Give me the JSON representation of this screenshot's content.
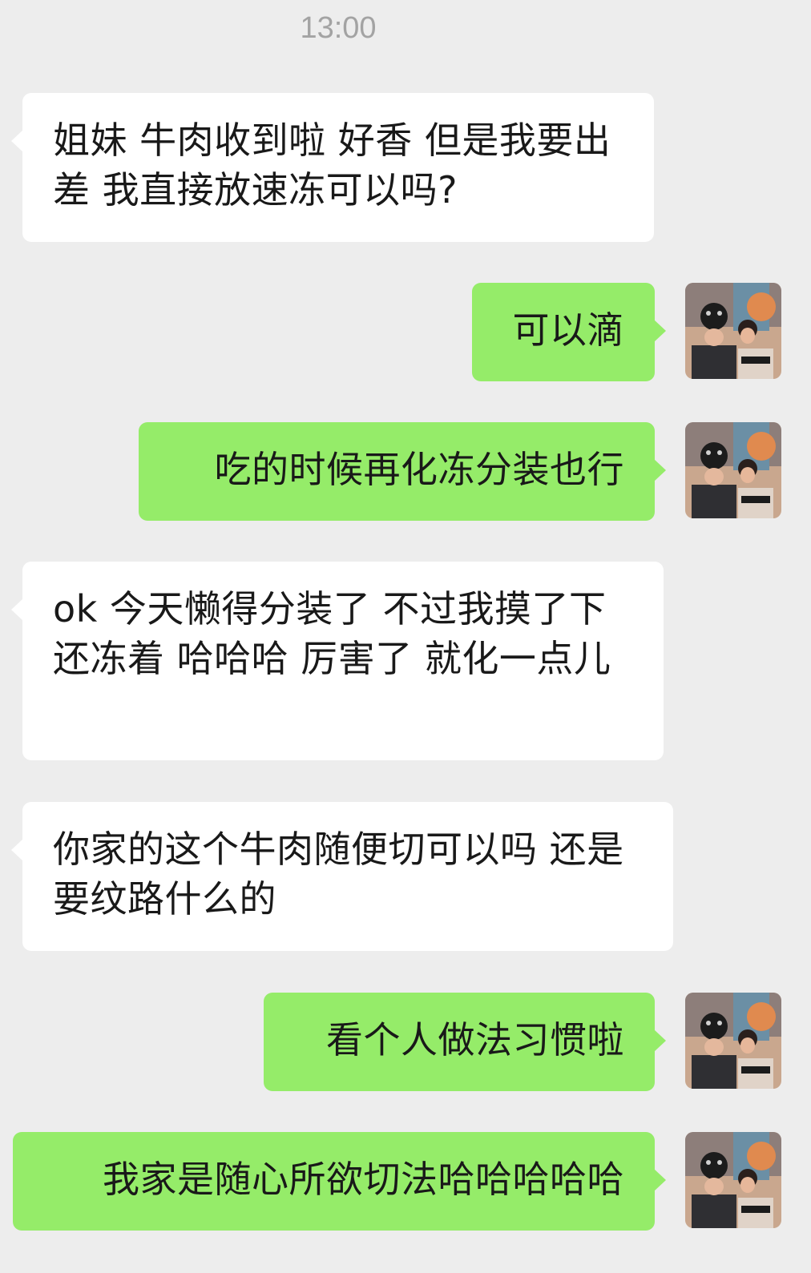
{
  "status": {
    "time": "13:00"
  },
  "messages": [
    {
      "side": "left",
      "text": "姐妹 牛肉收到啦 好香 但是我要出差 我直接放速冻可以吗?"
    },
    {
      "side": "right",
      "text": "可以滴"
    },
    {
      "side": "right",
      "text": "吃的时候再化冻分装也行"
    },
    {
      "side": "left",
      "text": "ok 今天懒得分装了 不过我摸了下 还冻着 哈哈哈 厉害了 就化一点儿"
    },
    {
      "side": "left",
      "text": "你家的这个牛肉随便切可以吗 还是要纹路什么的"
    },
    {
      "side": "right",
      "text": "看个人做法习惯啦"
    },
    {
      "side": "right",
      "text": "我家是随心所欲切法哈哈哈哈哈"
    }
  ],
  "colors": {
    "background": "#ededed",
    "bubble_self": "#95ec69",
    "bubble_other": "#ffffff",
    "timestamp": "#a3a3a3"
  },
  "icons": {
    "self_avatar": "user-avatar-photo-icon"
  }
}
